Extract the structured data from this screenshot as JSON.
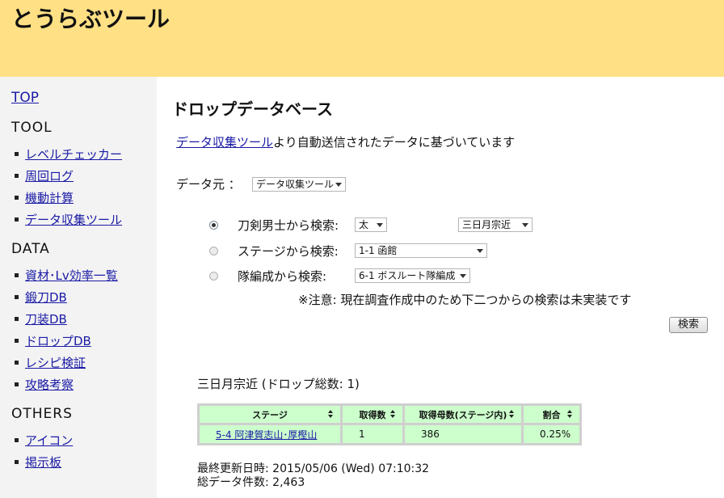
{
  "header": {
    "title": "とうらぶツール"
  },
  "sidebar": {
    "top_link": "TOP",
    "sections": [
      {
        "title": "TOOL",
        "items": [
          "レベルチェッカー",
          "周回ログ",
          "機動計算",
          "データ収集ツール"
        ]
      },
      {
        "title": "DATA",
        "items": [
          "資材･Lv効率一覧",
          "鍛刀DB",
          "刀装DB",
          "ドロップDB",
          "レシピ検証",
          "攻略考察"
        ]
      },
      {
        "title": "OTHERS",
        "items": [
          "アイコン",
          "掲示板"
        ]
      }
    ]
  },
  "main": {
    "title": "ドロップデータベース",
    "intro_link": "データ収集ツール",
    "intro_text": "より自動送信されたデータに基づいています",
    "source_label": "データ元  ：",
    "source_value": "データ収集ツール",
    "search": {
      "sword_label": "刀剣男士から検索:",
      "sword_type": "太",
      "sword_name": "三日月宗近",
      "stage_label": "ステージから検索:",
      "stage_value": "1-1 函館",
      "team_label": "隊編成から検索:",
      "team_value": "6-1 ボスルート隊編成",
      "note": "※注意:  現在調査作成中のため下二つからの検索は未実装です",
      "button": "検索",
      "selected_mode": "sword"
    },
    "result": {
      "heading": "三日月宗近  (ドロップ総数:  1)",
      "columns": [
        "ステージ",
        "取得数",
        "取得母数(ステージ内)",
        "割合"
      ],
      "rows": [
        {
          "stage": "5-4 阿津賀志山･厚樫山",
          "count": "1",
          "total": "386",
          "rate": "0.25%"
        }
      ]
    },
    "footer": {
      "updated": "最終更新日時:  2015/05/06 (Wed) 07:10:32",
      "total": "総データ件数:  2,463"
    }
  },
  "colors": {
    "header_bg": "#ffe085",
    "sidebar_bg": "#f3f3f3",
    "table_cell_bg": "#ccffcc",
    "link": "#1a1aa6"
  }
}
